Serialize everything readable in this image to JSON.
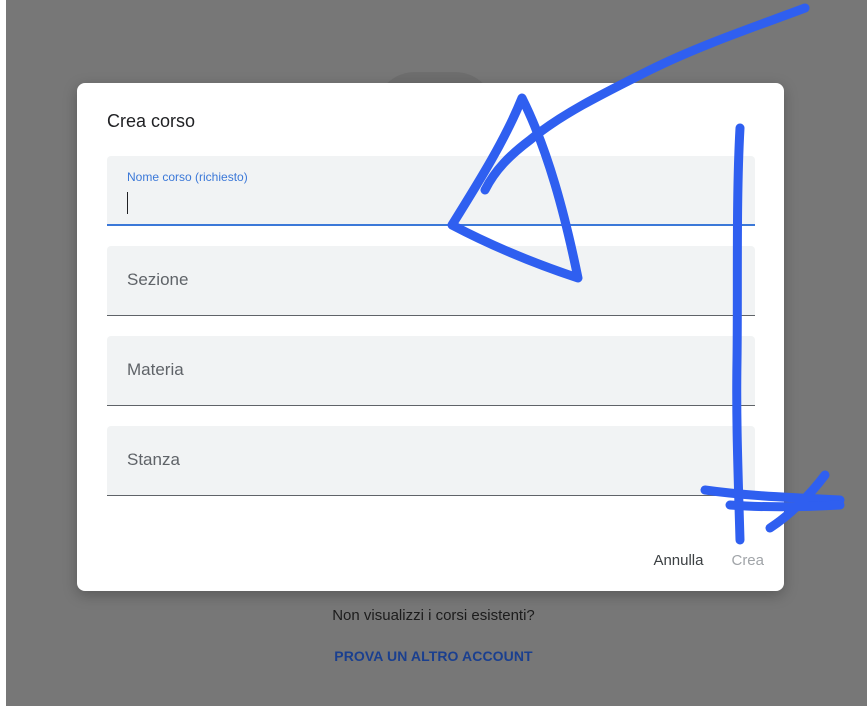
{
  "dialog": {
    "title": "Crea corso",
    "fields": {
      "course_name": {
        "label": "Nome corso (richiesto)",
        "value": ""
      },
      "section": {
        "placeholder": "Sezione"
      },
      "subject": {
        "placeholder": "Materia"
      },
      "room": {
        "placeholder": "Stanza"
      }
    },
    "actions": {
      "cancel_label": "Annulla",
      "create_label": "Crea"
    }
  },
  "background": {
    "question_text": "Non visualizzi i corsi esistenti?",
    "try_account_link": "PROVA UN ALTRO ACCOUNT"
  },
  "colors": {
    "accent": "#3b78d8",
    "annotation_ink": "#2f5ff0",
    "backdrop": "#777777",
    "link": "#1a3f8f"
  }
}
